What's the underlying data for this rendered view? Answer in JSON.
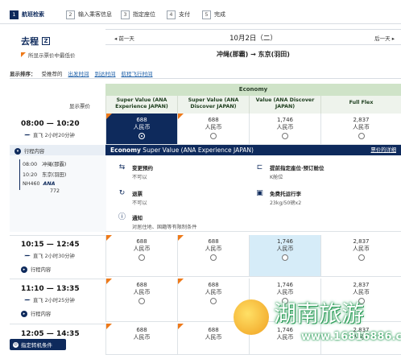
{
  "steps": [
    {
      "num": "1",
      "label": "航班检索",
      "active": true
    },
    {
      "num": "2",
      "label": "输入乘客信息",
      "active": false
    },
    {
      "num": "3",
      "label": "指定座位",
      "active": false
    },
    {
      "num": "4",
      "label": "支付",
      "active": false
    },
    {
      "num": "5",
      "label": "完成",
      "active": false
    }
  ],
  "trip": {
    "title": "去程",
    "note": "所显示票价中最低价"
  },
  "date_nav": {
    "prev": "前一天",
    "date": "10月2日（二）",
    "next": "后一天"
  },
  "route": {
    "from": "冲绳(那霸)",
    "arrow": "→",
    "to": "东京(羽田)"
  },
  "sort": {
    "label": "显示排序：",
    "current": "受推荐的",
    "options": [
      "出发时间",
      "到达时间",
      "航程飞行时间"
    ]
  },
  "fare_table": {
    "cabin": "Economy",
    "show_label": "显示票价",
    "columns": [
      "Super Value (ANA Experience JAPAN)",
      "Super Value (ANA Discover JAPAN)",
      "Value (ANA Discover JAPAN)",
      "Full Flex"
    ],
    "currency": "人民币"
  },
  "flights": [
    {
      "dep": "08:00",
      "arr": "10:20",
      "duration": "直飞 2小时20分钟",
      "detail": "行程内容",
      "prices": [
        "688",
        "688",
        "1,746",
        "2,837"
      ]
    },
    {
      "dep": "10:15",
      "arr": "12:45",
      "duration": "直飞 2小时30分钟",
      "detail": "行程内容",
      "prices": [
        "688",
        "688",
        "1,746",
        "2,837"
      ]
    },
    {
      "dep": "11:10",
      "arr": "13:35",
      "duration": "直飞 2小时25分钟",
      "detail": "行程内容",
      "prices": [
        "688",
        "688",
        "1,746",
        "2,837"
      ]
    },
    {
      "dep": "12:05",
      "arr": "14:35",
      "duration": "",
      "detail": "",
      "prices": [
        "688",
        "688",
        "1,746",
        "2,837"
      ]
    }
  ],
  "detail": {
    "title_bold": "Economy",
    "title_rest": " Super Value (ANA Experience JAPAN)",
    "rule_link": "票价的详细",
    "leg": {
      "dep_time": "08:00",
      "dep_airport": "冲绳(那霸)",
      "arr_time": "10:20",
      "arr_airport": "东京(羽田)",
      "flight_no": "NH460",
      "aircraft": "772",
      "airline": "ANA"
    },
    "features": [
      {
        "icon": "ticket-icon",
        "title": "变更预约",
        "sub": "不可以"
      },
      {
        "icon": "seat-icon",
        "title": "提前指定座位·预订舱位",
        "sub": "K舱位"
      },
      {
        "icon": "refund-icon",
        "title": "退票",
        "sub": "不可以"
      },
      {
        "icon": "baggage-icon",
        "title": "免费托运行李",
        "sub": "23kg/50磅x2"
      },
      {
        "icon": "info-icon",
        "title": "通知",
        "sub": "对居住地、国籍等有限制条件"
      }
    ]
  },
  "bottom_button": "指定转机条件",
  "watermark": {
    "text": "湖南旅游",
    "url": "www.16816886.com"
  },
  "colors": {
    "brand": "#0e2a5c",
    "economy": "#cfe3c8",
    "accent": "#ee7a1a",
    "highlight": "#d6ecf8"
  }
}
